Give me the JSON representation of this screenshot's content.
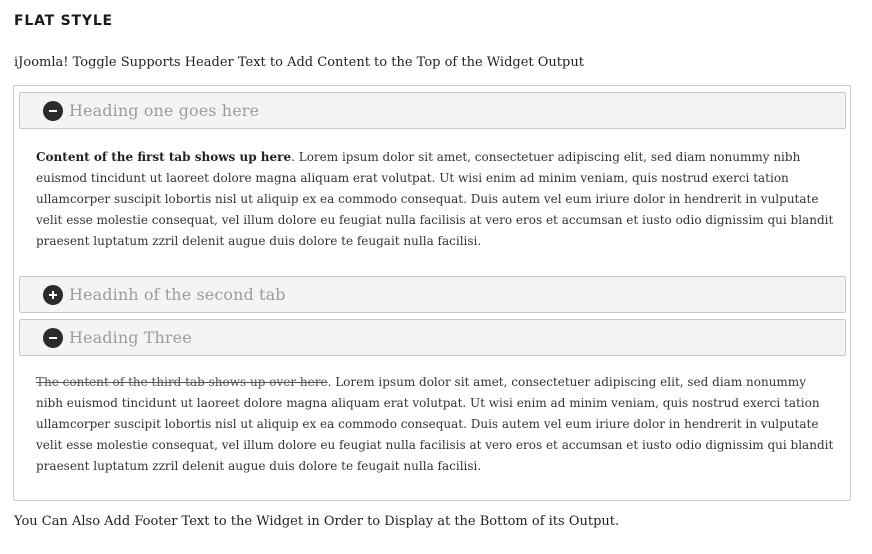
{
  "section": {
    "title": "FLAT STYLE",
    "header_text": "iJoomla! Toggle Supports Header Text to Add Content to the Top of the Widget Output",
    "footer_text": "You Can Also Add Footer Text to the Widget in Order to Display at the Bottom of its Output."
  },
  "tabs": [
    {
      "heading": "Heading one goes here",
      "icon": "minus-circle-icon",
      "expanded": true,
      "lead": "Content of the first tab shows up here",
      "lead_style": "bold",
      "body": ". Lorem ipsum dolor sit amet, consectetuer adipiscing elit, sed diam nonummy nibh euismod tincidunt ut laoreet dolore magna aliquam erat volutpat. Ut wisi enim ad minim veniam, quis nostrud exerci tation ullamcorper suscipit lobortis nisl ut aliquip ex ea commodo consequat. Duis autem vel eum iriure dolor in hendrerit in vulputate velit esse molestie consequat, vel illum dolore eu feugiat nulla facilisis at vero eros et accumsan et iusto odio dignissim qui blandit praesent luptatum zzril delenit augue duis dolore te feugait nulla facilisi."
    },
    {
      "heading": "Headinh of the second tab",
      "icon": "plus-circle-icon",
      "expanded": false
    },
    {
      "heading": "Heading Three",
      "icon": "minus-circle-icon",
      "expanded": true,
      "lead": "The content of the third tab shows up over here",
      "lead_style": "strikethrough",
      "body": ". Lorem ipsum dolor sit amet, consectetuer adipiscing elit, sed diam nonummy nibh euismod tincidunt ut laoreet dolore magna aliquam erat volutpat. Ut wisi enim ad minim veniam, quis nostrud exerci tation ullamcorper suscipit lobortis nisl ut aliquip ex ea commodo consequat. Duis autem vel eum iriure dolor in hendrerit in vulputate velit esse molestie consequat, vel illum dolore eu feugiat nulla facilisis at vero eros et accumsan et iusto odio dignissim qui blandit praesent luptatum zzril delenit augue duis dolore te feugait nulla facilisi."
    }
  ],
  "colors": {
    "heading_text": "#9d9d9d",
    "icon_bg": "#2b2b2b",
    "border": "#c8c8c8",
    "heading_bg": "#f4f4f4"
  }
}
